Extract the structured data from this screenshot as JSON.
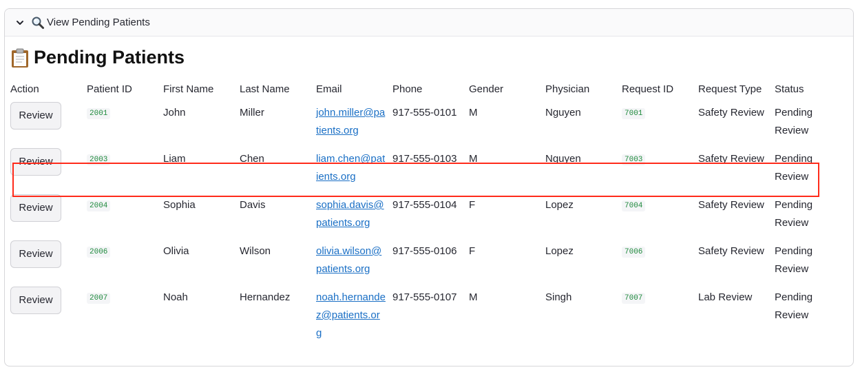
{
  "expander": {
    "label": "View Pending Patients",
    "icon": "magnifier-icon",
    "chevron": "chevron-down-icon"
  },
  "section": {
    "title": "Pending Patients",
    "icon": "clipboard-icon"
  },
  "table": {
    "headers": [
      "Action",
      "Patient ID",
      "First Name",
      "Last Name",
      "Email",
      "Phone",
      "Gender",
      "Physician",
      "Request ID",
      "Request Type",
      "Status"
    ],
    "rows": [
      {
        "action": "Review",
        "patient_id": "2001",
        "first": "John",
        "last": "Miller",
        "email": "john.miller@patients.org",
        "phone": "917-555-0101",
        "gender": "M",
        "physician": "Nguyen",
        "request_id": "7001",
        "request_type": "Safety Review",
        "status": "Pending Review"
      },
      {
        "action": "Review",
        "patient_id": "2003",
        "first": "Liam",
        "last": "Chen",
        "email": "liam.chen@patients.org",
        "phone": "917-555-0103",
        "gender": "M",
        "physician": "Nguyen",
        "request_id": "7003",
        "request_type": "Safety Review",
        "status": "Pending Review"
      },
      {
        "action": "Review",
        "patient_id": "2004",
        "first": "Sophia",
        "last": "Davis",
        "email": "sophia.davis@patients.org",
        "phone": "917-555-0104",
        "gender": "F",
        "physician": "Lopez",
        "request_id": "7004",
        "request_type": "Safety Review",
        "status": "Pending Review"
      },
      {
        "action": "Review",
        "patient_id": "2006",
        "first": "Olivia",
        "last": "Wilson",
        "email": "olivia.wilson@patients.org",
        "phone": "917-555-0106",
        "gender": "F",
        "physician": "Lopez",
        "request_id": "7006",
        "request_type": "Safety Review",
        "status": "Pending Review"
      },
      {
        "action": "Review",
        "patient_id": "2007",
        "first": "Noah",
        "last": "Hernandez",
        "email": "noah.hernandez@patients.org",
        "phone": "917-555-0107",
        "gender": "M",
        "physician": "Singh",
        "request_id": "7007",
        "request_type": "Lab Review",
        "status": "Pending Review"
      }
    ]
  },
  "colors": {
    "highlight_border": "#ff2a1a",
    "link": "#1a6fc5",
    "code_text": "#1f8a3d"
  }
}
